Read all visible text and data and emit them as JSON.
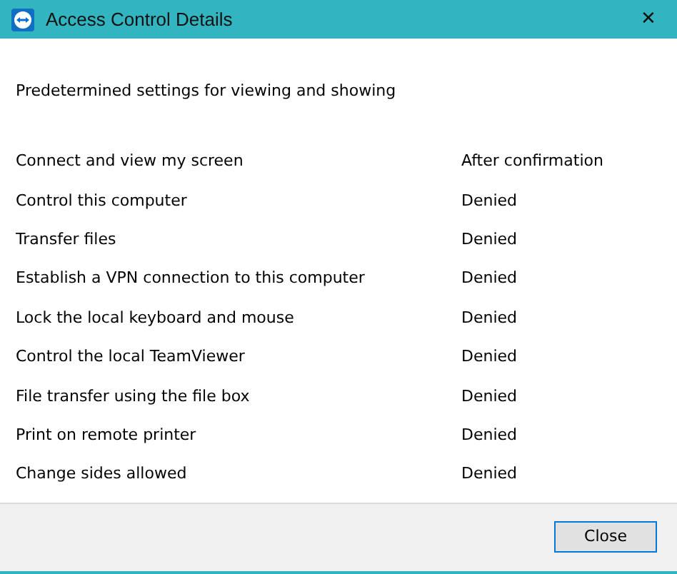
{
  "window": {
    "title": "Access Control Details",
    "close": "✕"
  },
  "heading": "Predetermined settings for viewing and showing",
  "settings": [
    {
      "name": "Connect and view my screen",
      "value": "After confirmation"
    },
    {
      "name": "Control this computer",
      "value": "Denied"
    },
    {
      "name": "Transfer files",
      "value": "Denied"
    },
    {
      "name": "Establish a VPN connection to this computer",
      "value": "Denied"
    },
    {
      "name": "Lock the local keyboard and mouse",
      "value": "Denied"
    },
    {
      "name": "Control the local TeamViewer",
      "value": "Denied"
    },
    {
      "name": "File transfer using the file box",
      "value": "Denied"
    },
    {
      "name": "Print on remote printer",
      "value": "Denied"
    },
    {
      "name": "Change sides allowed",
      "value": "Denied"
    }
  ],
  "buttons": [
    "Close"
  ]
}
